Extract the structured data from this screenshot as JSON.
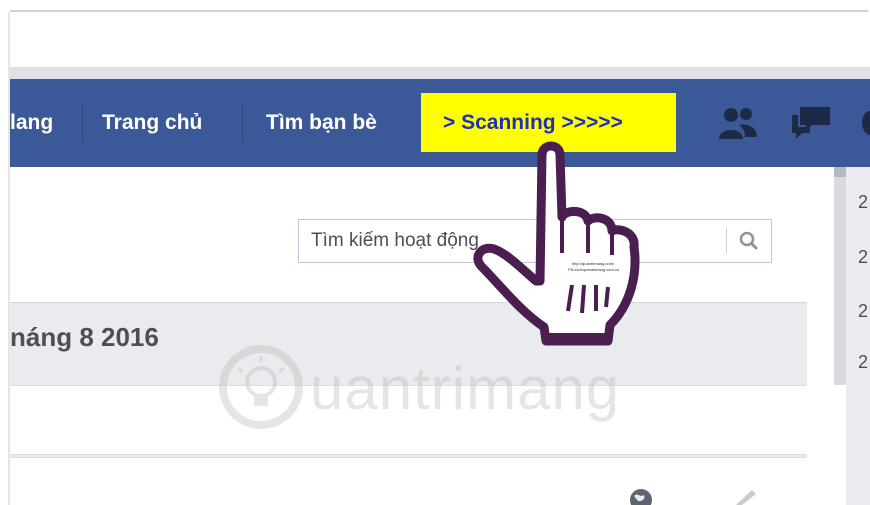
{
  "nav": {
    "items": [
      {
        "label": "lang"
      },
      {
        "label": "Trang chủ"
      },
      {
        "label": "Tìm bạn bè"
      }
    ],
    "scanning_label": "> Scanning  >>>>>",
    "scanning_color": "#ffff00",
    "bar_color": "#3b5998",
    "icons": [
      "friends-icon",
      "messages-icon"
    ]
  },
  "search": {
    "placeholder": "Tìm kiếm hoạt động",
    "icon": "search-icon"
  },
  "timeline": {
    "date_heading": "náng 8 2016"
  },
  "right_column": {
    "values": [
      "2",
      "2",
      "2",
      "2"
    ]
  },
  "watermark": {
    "text": "uantrimang",
    "small_lines": [
      "http://quantrimang.com/",
      "FB.com/quantrimang.com.vn"
    ]
  }
}
